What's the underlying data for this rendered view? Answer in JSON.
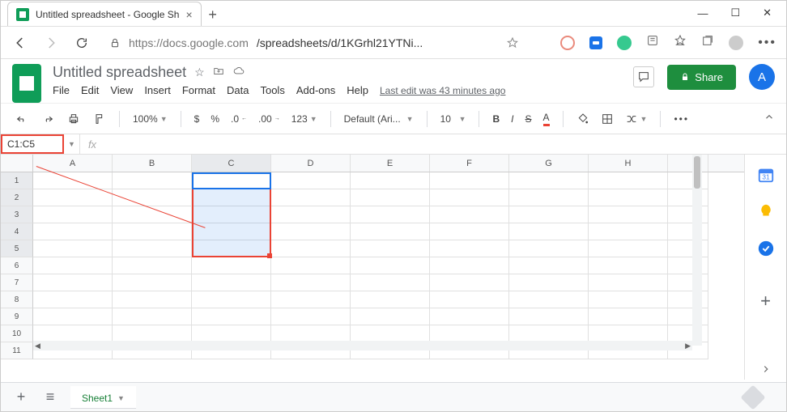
{
  "browser": {
    "tab_title": "Untitled spreadsheet - Google Sh",
    "url_host": "https://docs.google.com",
    "url_path": "/spreadsheets/d/1KGrhl21YTNi..."
  },
  "doc": {
    "title": "Untitled spreadsheet",
    "menus": [
      "File",
      "Edit",
      "View",
      "Insert",
      "Format",
      "Data",
      "Tools",
      "Add-ons",
      "Help"
    ],
    "last_edit": "Last edit was 43 minutes ago",
    "share_label": "Share",
    "avatar_initial": "A"
  },
  "toolbar": {
    "zoom": "100%",
    "number_more": "123",
    "font": "Default (Ari...",
    "font_size": "10"
  },
  "formula": {
    "name_box": "C1:C5",
    "fx": "fx",
    "input": ""
  },
  "grid": {
    "columns": [
      "A",
      "B",
      "C",
      "D",
      "E",
      "F",
      "G",
      "H",
      ""
    ],
    "rows": [
      "1",
      "2",
      "3",
      "4",
      "5",
      "6",
      "7",
      "8",
      "9",
      "10",
      "11"
    ],
    "selected_column_index": 2,
    "selected_rows": [
      0,
      1,
      2,
      3,
      4
    ]
  },
  "sheets": {
    "active": "Sheet1"
  }
}
